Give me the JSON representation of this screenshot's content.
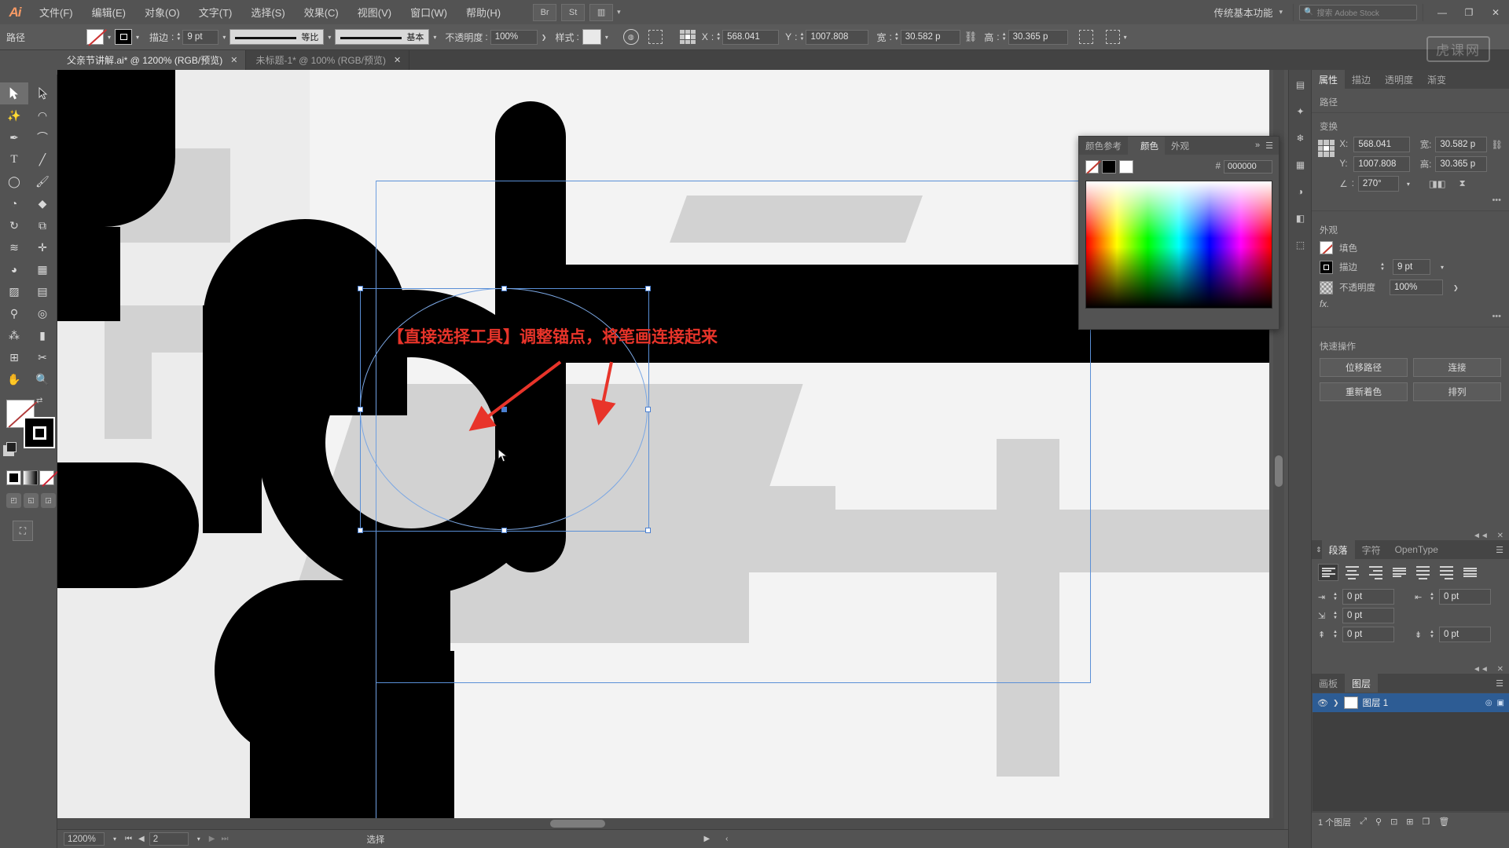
{
  "app": {
    "name": "Ai",
    "workspace": "传统基本功能",
    "search_placeholder": "搜索 Adobe Stock",
    "watermark": "虎课网"
  },
  "menus": [
    {
      "label": "文件(F)"
    },
    {
      "label": "编辑(E)"
    },
    {
      "label": "对象(O)"
    },
    {
      "label": "文字(T)"
    },
    {
      "label": "选择(S)"
    },
    {
      "label": "效果(C)"
    },
    {
      "label": "视图(V)"
    },
    {
      "label": "窗口(W)"
    },
    {
      "label": "帮助(H)"
    }
  ],
  "menubar_icons": [
    {
      "name": "bridge-icon",
      "glyph": "Br"
    },
    {
      "name": "stock-icon",
      "glyph": "St"
    },
    {
      "name": "arrange-documents-icon",
      "glyph": "▥"
    }
  ],
  "window_buttons": [
    {
      "name": "minimize-button",
      "glyph": "—"
    },
    {
      "name": "restore-button",
      "glyph": "❐"
    },
    {
      "name": "close-button",
      "glyph": "✕"
    }
  ],
  "control_bar": {
    "object_type": "路径",
    "fill_label": "填色",
    "stroke_label": "描边",
    "stroke_weight": "9 pt",
    "stroke_profile": "等比",
    "brush_definition": "基本",
    "opacity_label": "不透明度",
    "opacity_value": "100%",
    "style_label": "样式",
    "x_label": "X",
    "x_value": "568.041",
    "y_label": "Y",
    "y_value": "1007.808",
    "w_label": "宽",
    "w_value": "30.582 p",
    "h_label": "高",
    "h_value": "30.365 p"
  },
  "tabs": [
    {
      "title": "父亲节讲解.ai* @ 1200% (RGB/预览)",
      "active": true,
      "closable": true
    },
    {
      "title": "未标题-1* @ 100% (RGB/预览)",
      "active": false,
      "closable": true
    }
  ],
  "tools": [
    {
      "name": "selection-tool",
      "glyph": "➤",
      "selected": false
    },
    {
      "name": "direct-selection-tool",
      "glyph": "➤",
      "selected": true
    },
    {
      "name": "magic-wand-tool",
      "glyph": "✨",
      "selected": false
    },
    {
      "name": "lasso-tool",
      "glyph": "◠",
      "selected": false
    },
    {
      "name": "pen-tool",
      "glyph": "✒",
      "selected": false
    },
    {
      "name": "curvature-tool",
      "glyph": "⌒",
      "selected": false
    },
    {
      "name": "type-tool",
      "glyph": "T",
      "selected": false
    },
    {
      "name": "line-segment-tool",
      "glyph": "╱",
      "selected": false
    },
    {
      "name": "ellipse-tool",
      "glyph": "◯",
      "selected": false
    },
    {
      "name": "paintbrush-tool",
      "glyph": "🖌",
      "selected": false
    },
    {
      "name": "shaper-tool",
      "glyph": "◔",
      "selected": false
    },
    {
      "name": "eraser-tool",
      "glyph": "◆",
      "selected": false
    },
    {
      "name": "rotate-tool",
      "glyph": "↻",
      "selected": false
    },
    {
      "name": "scale-tool",
      "glyph": "⧉",
      "selected": false
    },
    {
      "name": "width-tool",
      "glyph": "≋",
      "selected": false
    },
    {
      "name": "free-transform-tool",
      "glyph": "✛",
      "selected": false
    },
    {
      "name": "shape-builder-tool",
      "glyph": "◕",
      "selected": false
    },
    {
      "name": "perspective-grid-tool",
      "glyph": "▦",
      "selected": false
    },
    {
      "name": "mesh-tool",
      "glyph": "▨",
      "selected": false
    },
    {
      "name": "gradient-tool",
      "glyph": "▤",
      "selected": false
    },
    {
      "name": "eyedropper-tool",
      "glyph": "⚲",
      "selected": false
    },
    {
      "name": "blend-tool",
      "glyph": "◎",
      "selected": false
    },
    {
      "name": "symbol-sprayer-tool",
      "glyph": "⁂",
      "selected": false
    },
    {
      "name": "column-graph-tool",
      "glyph": "▮",
      "selected": false
    },
    {
      "name": "artboard-tool",
      "glyph": "⊞",
      "selected": false
    },
    {
      "name": "slice-tool",
      "glyph": "✂",
      "selected": false
    },
    {
      "name": "hand-tool",
      "glyph": "✋",
      "selected": false
    },
    {
      "name": "zoom-tool",
      "glyph": "🔍",
      "selected": false
    }
  ],
  "color_panel": {
    "tabs": [
      {
        "label": "颜色参考",
        "active": false
      },
      {
        "label": "颜色",
        "active": true
      },
      {
        "label": "外观",
        "active": false
      }
    ],
    "hex_prefix": "#",
    "hex_value": "000000",
    "menu_icon": "panel-menu-icon",
    "collapse_icon": "collapse-icon"
  },
  "properties": {
    "tabs": [
      {
        "label": "属性",
        "active": true
      },
      {
        "label": "描边",
        "active": false
      },
      {
        "label": "透明度",
        "active": false
      },
      {
        "label": "渐变",
        "active": false
      }
    ],
    "section_path": "路径",
    "section_transform": "变换",
    "x_label": "X:",
    "x_value": "568.041",
    "y_label": "Y:",
    "y_value": "1007.808",
    "w_label": "宽:",
    "w_value": "30.582 p",
    "h_label": "高:",
    "h_value": "30.365 p",
    "angle_value": "270°",
    "section_appearance": "外观",
    "fill_label": "填色",
    "stroke_label": "描边",
    "stroke_value": "9 pt",
    "opacity_label": "不透明度",
    "opacity_value": "100%",
    "fx_label": "fx.",
    "quick_actions_label": "快速操作",
    "quick_actions": [
      {
        "label": "位移路径"
      },
      {
        "label": "连接"
      },
      {
        "label": "重新着色"
      },
      {
        "label": "排列"
      }
    ]
  },
  "paragraph_panel": {
    "tabs": [
      {
        "label": "段落",
        "active": true
      },
      {
        "label": "字符",
        "active": false
      },
      {
        "label": "OpenType",
        "active": false
      }
    ],
    "align_buttons": [
      {
        "name": "align-left",
        "active": true
      },
      {
        "name": "align-center",
        "active": false
      },
      {
        "name": "align-right",
        "active": false
      },
      {
        "name": "justify-last-left",
        "active": false
      },
      {
        "name": "justify-last-center",
        "active": false
      },
      {
        "name": "justify-last-right",
        "active": false
      },
      {
        "name": "justify-all",
        "active": false
      }
    ],
    "fields": [
      {
        "name": "left-indent",
        "value": "0 pt"
      },
      {
        "name": "right-indent",
        "value": "0 pt"
      },
      {
        "name": "first-line-indent",
        "value": "0 pt"
      },
      {
        "name": "space-before",
        "value": "0 pt"
      },
      {
        "name": "space-after",
        "value": "0 pt"
      }
    ]
  },
  "layers_panel": {
    "tabs": [
      {
        "label": "画板",
        "active": false
      },
      {
        "label": "图层",
        "active": true
      }
    ],
    "rows": [
      {
        "name": "图层 1",
        "visible": true,
        "expandable": true,
        "selected": true
      }
    ],
    "footer_count": "1 个图层",
    "footer_icons": [
      {
        "name": "locate-object-icon",
        "glyph": "⤢"
      },
      {
        "name": "make-clipping-mask-icon",
        "glyph": "⚲"
      },
      {
        "name": "create-sublayer-icon",
        "glyph": "⊡"
      },
      {
        "name": "new-layer-icon",
        "glyph": "⊞"
      },
      {
        "name": "duplicate-layer-icon",
        "glyph": "❐"
      },
      {
        "name": "delete-layer-icon",
        "glyph": "🗑"
      }
    ]
  },
  "canvas": {
    "annotation": "【直接选择工具】调整锚点，将笔画连接起来",
    "annotation_color": "#e8342a"
  },
  "status_bar": {
    "zoom": "1200%",
    "page": "2",
    "tool_status": "选择",
    "nav_first": "⏮",
    "nav_prev": "◀",
    "nav_next": "▶",
    "nav_last": "⏭"
  },
  "dock_icons": [
    {
      "name": "libraries-icon",
      "glyph": "▤"
    },
    {
      "name": "brushes-icon",
      "glyph": "✦"
    },
    {
      "name": "symbols-icon",
      "glyph": "❄"
    },
    {
      "name": "swatches-icon",
      "glyph": "▦"
    },
    {
      "name": "color-guide-icon",
      "glyph": "◑"
    },
    {
      "name": "pathfinder-icon",
      "glyph": "◧"
    },
    {
      "name": "transform-icon",
      "glyph": "⬚"
    }
  ],
  "colors": {
    "accent_blue": "#2d5c94",
    "annotation_red": "#e8342a",
    "panel_bg": "#535353",
    "canvas_bg": "#ececec"
  }
}
